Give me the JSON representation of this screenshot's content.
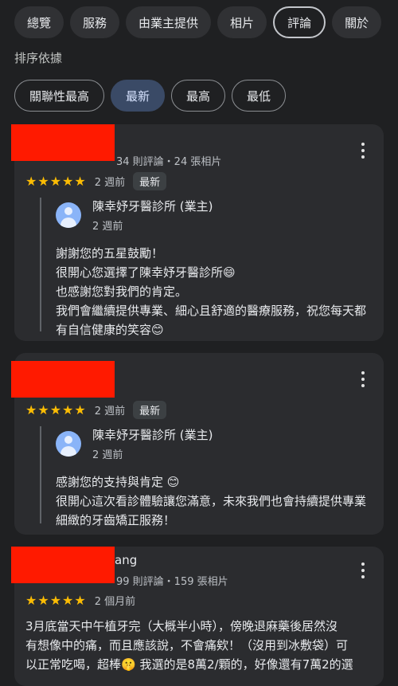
{
  "tabs": [
    "總覽",
    "服務",
    "由業主提供",
    "相片",
    "評論",
    "關於"
  ],
  "sort": {
    "label": "排序依據",
    "options": [
      "關聯性最高",
      "最新",
      "最高",
      "最低"
    ]
  },
  "reviews": [
    {
      "meta": "34 則評論・24 張相片",
      "stars": "★★★★★",
      "time": "2 週前",
      "badge": "最新",
      "reply": {
        "owner": "陳幸妤牙醫診所 (業主)",
        "time": "2 週前",
        "lines": [
          "謝謝您的五星鼓勵！",
          "很開心您選擇了陳幸妤牙醫診所😄",
          "也感謝您對我們的肯定。",
          "我們會繼續提供專業、細心且舒適的醫療服務，祝您每天都",
          "有自信健康的笑容😊"
        ]
      }
    },
    {
      "stars": "★★★★★",
      "time": "2 週前",
      "badge": "最新",
      "reply": {
        "owner": "陳幸妤牙醫診所 (業主)",
        "time": "2 週前",
        "lines": [
          "感謝您的支持與肯定 😊",
          "很開心這次看診體驗讓您滿意，未來我們也會持續提供專業",
          "細緻的牙齒矯正服務！"
        ]
      }
    },
    {
      "name_partial": "ang",
      "meta": "99 則評論・159 張相片",
      "stars": "★★★★★",
      "time": "2 個月前",
      "lines": [
        "3月底當天中午植牙完（大概半小時），傍晚退麻藥後居然沒",
        "有想像中的痛，而且應該說，不會痛欸！（沒用到冰敷袋）可",
        "以正常吃喝，超棒🤫 我選的是8萬2/顆的，好像還有7萬2的選"
      ]
    }
  ]
}
